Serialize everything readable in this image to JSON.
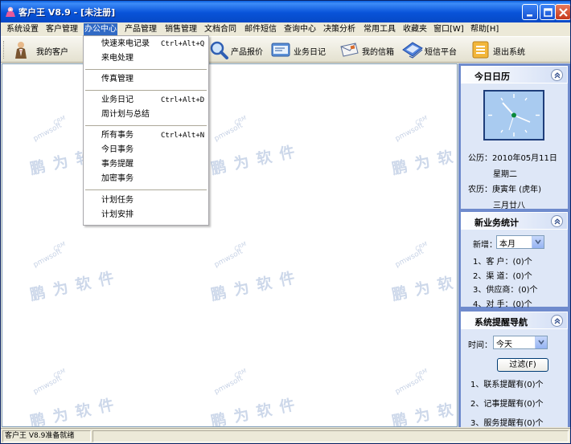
{
  "window": {
    "title": "客户王  V8.9 - [未注册]"
  },
  "menubar": {
    "items": [
      "系统设置",
      "客户管理",
      "办公中心",
      "产品管理",
      "销售管理",
      "文档合同",
      "邮件短信",
      "查询中心",
      "决策分析",
      "常用工具",
      "收藏夹",
      "窗口[W]",
      "帮助[H]"
    ],
    "active": "办公中心"
  },
  "toolbar": {
    "buttons": [
      {
        "label": "我的客户",
        "icon": "customer-icon"
      },
      {
        "label": "产品报价",
        "icon": "magnifier-icon"
      },
      {
        "label": "业务日记",
        "icon": "journal-icon"
      },
      {
        "label": "我的信箱",
        "icon": "mailbox-icon"
      },
      {
        "label": "短信平台",
        "icon": "sms-icon"
      },
      {
        "label": "退出系统",
        "icon": "exit-icon"
      }
    ]
  },
  "dropdown": {
    "items": [
      {
        "label": "快速来电记录",
        "shortcut": "Ctrl+Alt+Q"
      },
      {
        "label": "来电处理",
        "shortcut": ""
      },
      {
        "label": "传真管理",
        "shortcut": ""
      },
      {
        "label": "业务日记",
        "shortcut": "Ctrl+Alt+D"
      },
      {
        "label": "周计划与总结",
        "shortcut": ""
      },
      {
        "label": "所有事务",
        "shortcut": "Ctrl+Alt+N"
      },
      {
        "label": "今日事务",
        "shortcut": ""
      },
      {
        "label": "事务提醒",
        "shortcut": ""
      },
      {
        "label": "加密事务",
        "shortcut": ""
      },
      {
        "label": "计划任务",
        "shortcut": ""
      },
      {
        "label": "计划安排",
        "shortcut": ""
      }
    ]
  },
  "watermark": {
    "brand": "pmwsoft",
    "logo": "CRM",
    "chars": "鹏为软件"
  },
  "calendar": {
    "title": "今日日历",
    "solar_date": "公历：2010年05月11日",
    "weekday": "星期二",
    "lunar_year": "农历：庚寅年 (虎年)",
    "lunar_day": "三月廿八"
  },
  "new_business": {
    "title": "新业务统计",
    "label": "新增：",
    "period": "本月",
    "rows": [
      "1、客  户：(0)个",
      "2、渠  道：(0)个",
      "3、供应商：(0)个",
      "4、对  手：(0)个"
    ]
  },
  "reminders": {
    "title": "系统提醒导航",
    "time_label": "时间：",
    "time_value": "今天",
    "filter_button": "过滤(F)",
    "rows": [
      "1、联系提醒有(0)个",
      "2、记事提醒有(0)个",
      "3、服务提醒有(0)个"
    ]
  },
  "status": {
    "text": "客户王 V8.9准备就绪"
  },
  "colors": {
    "titlebar": "#0853D9",
    "menu_highlight": "#316AC5",
    "sidebar": "#6F8BCD",
    "clock_face": "#A9CBF0"
  }
}
